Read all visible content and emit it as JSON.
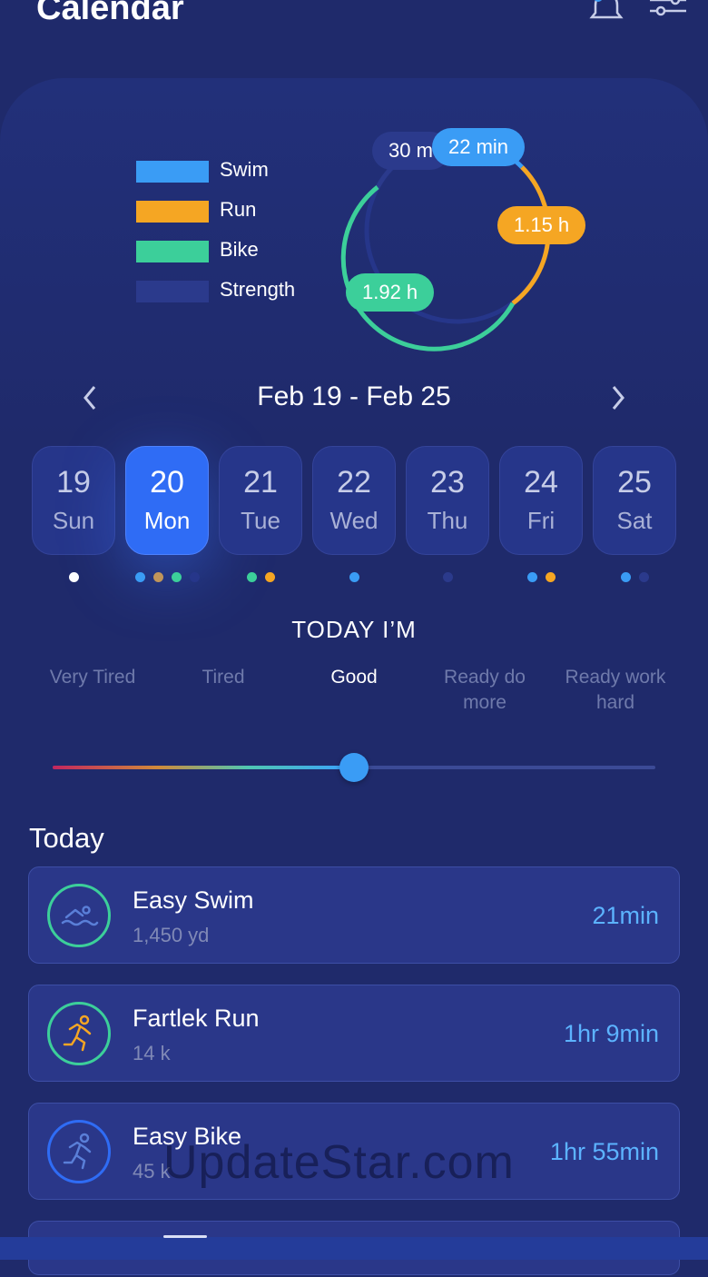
{
  "header": {
    "title": "Calendar",
    "bell_icon": "bell-icon",
    "filter_icon": "sliders-icon"
  },
  "legend": [
    {
      "label": "Swim",
      "color": "#3a9cf5"
    },
    {
      "label": "Run",
      "color": "#f5a623"
    },
    {
      "label": "Bike",
      "color": "#3ccf9a"
    },
    {
      "label": "Strength",
      "color": "#2b3a8c"
    }
  ],
  "ring": {
    "labels": {
      "strength": "30 m",
      "swim": "22 min",
      "run": "1.15 h",
      "bike": "1.92 h"
    }
  },
  "week": {
    "label": "Feb 19 - Feb 25",
    "prev_icon": "chevron-left-icon",
    "next_icon": "chevron-right-icon"
  },
  "days": [
    {
      "num": "19",
      "name": "Sun",
      "selected": false,
      "dots": [
        "#ffffff"
      ]
    },
    {
      "num": "20",
      "name": "Mon",
      "selected": true,
      "dots": [
        "#3a9cf5",
        "#c0955a",
        "#3ccf9a",
        "#26368a"
      ]
    },
    {
      "num": "21",
      "name": "Tue",
      "selected": false,
      "dots": [
        "#3ccf9a",
        "#f5a623"
      ]
    },
    {
      "num": "22",
      "name": "Wed",
      "selected": false,
      "dots": [
        "#3a9cf5"
      ]
    },
    {
      "num": "23",
      "name": "Thu",
      "selected": false,
      "dots": [
        "#2b3a8c"
      ]
    },
    {
      "num": "24",
      "name": "Fri",
      "selected": false,
      "dots": [
        "#3a9cf5",
        "#f5a623"
      ]
    },
    {
      "num": "25",
      "name": "Sat",
      "selected": false,
      "dots": [
        "#3a9cf5",
        "#2b3a8c"
      ]
    }
  ],
  "mood": {
    "title": "TODAY I’M",
    "options": [
      "Very Tired",
      "Tired",
      "Good",
      "Ready do more",
      "Ready work hard"
    ],
    "selected_index": 2,
    "slider_value_fraction": 0.5
  },
  "today": {
    "label": "Today",
    "workouts": [
      {
        "name": "Easy Swim",
        "detail": "1,450 yd",
        "duration": "21min",
        "icon": "swim-icon",
        "ring_color": "#3ccf9a",
        "icon_color": "#5a7fd8"
      },
      {
        "name": "Fartlek Run",
        "detail": "14 k",
        "duration": "1hr 9min",
        "icon": "run-icon",
        "ring_color": "#3ccf9a",
        "icon_color": "#f5a623"
      },
      {
        "name": "Easy Bike",
        "detail": "45 k",
        "duration": "1hr 55min",
        "icon": "bike-runner-icon",
        "ring_color": "#2f6cf5",
        "icon_color": "#5a7fd8"
      }
    ]
  },
  "watermark": "UpdateStar.com"
}
